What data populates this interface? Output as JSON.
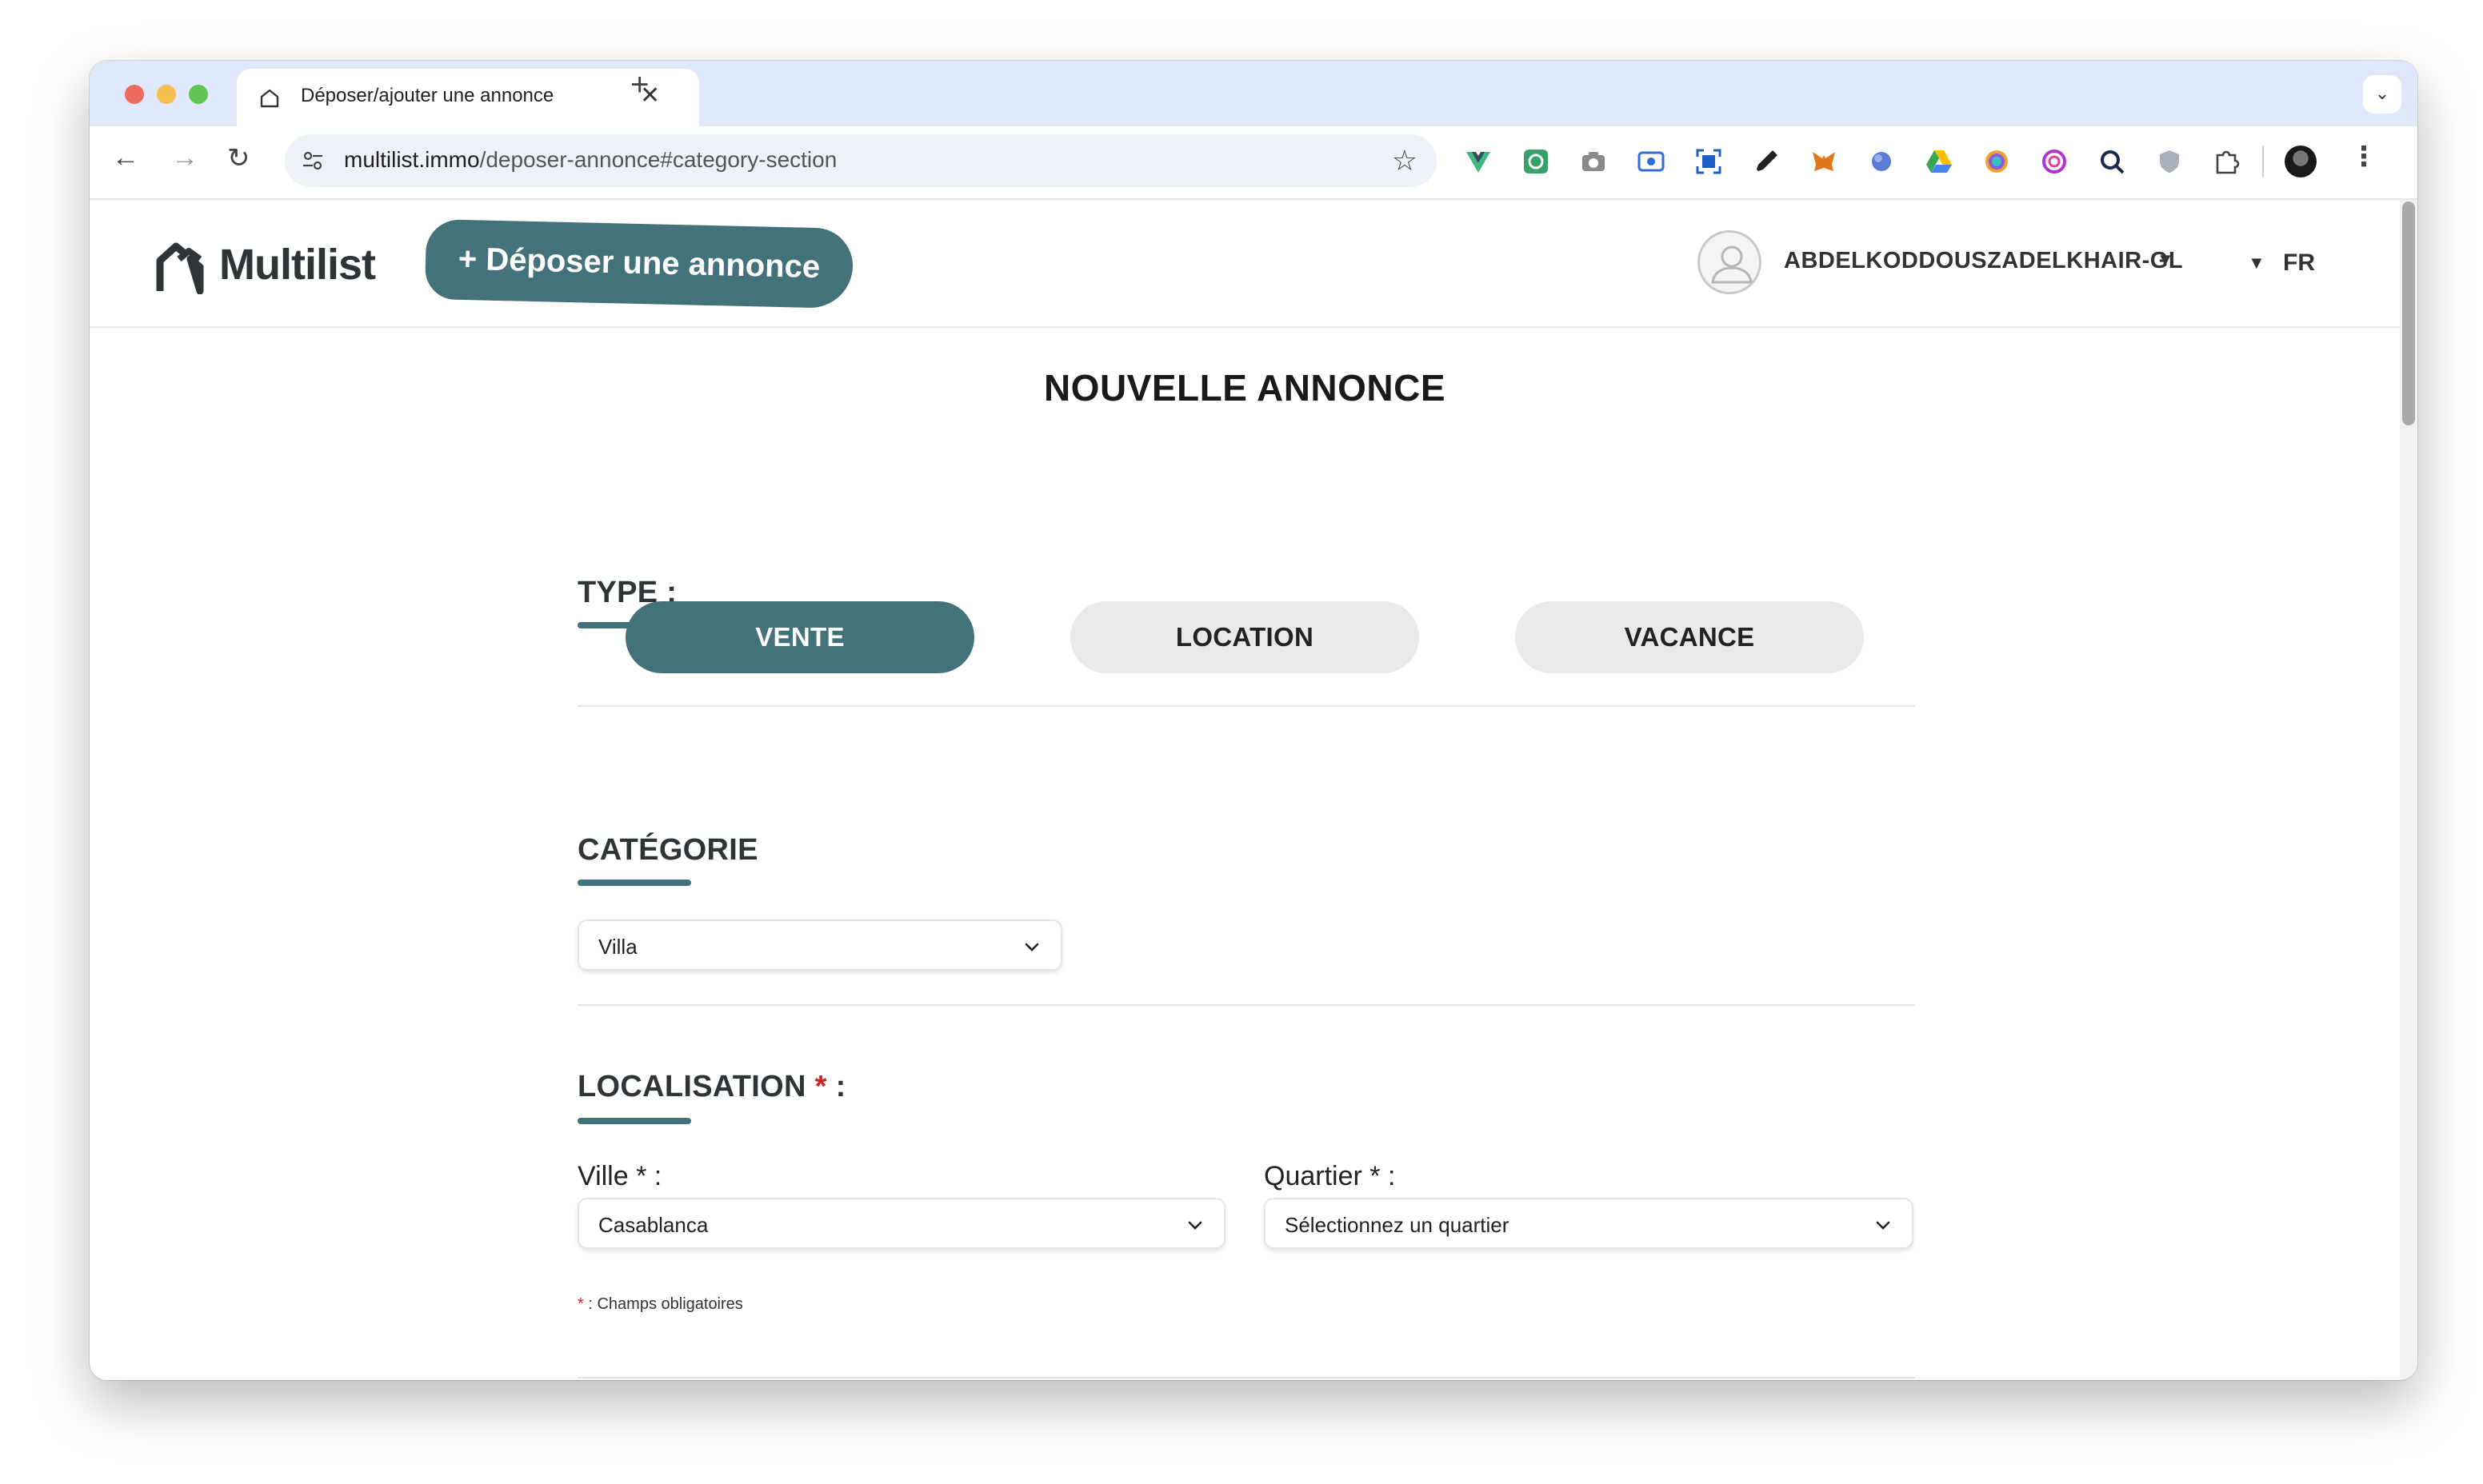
{
  "browser": {
    "tab_title": "Déposer/ajouter une annonce",
    "tab_close": "✕",
    "new_tab": "+",
    "url_host": "multilist.immo",
    "url_path": "/deposer-annonce#category-section",
    "extensions": [
      "vue-devtools-icon",
      "green-ext-icon",
      "camera-icon",
      "screen-record-icon",
      "screenshot-icon",
      "eyedropper-icon",
      "metamask-icon",
      "globe-ext-icon",
      "google-drive-icon",
      "rainbow-ext-icon",
      "swirl-ext-icon",
      "search-ext-icon",
      "shield-ext-icon",
      "puzzle-icon"
    ]
  },
  "header": {
    "logo_text": "Multilist",
    "post_button": "+ Déposer une annonce",
    "user_name": "ABDELKODDOUSZADELKHAIR-GL",
    "language": "FR"
  },
  "main": {
    "title": "NOUVELLE ANNONCE",
    "type_section": {
      "title": "TYPE :",
      "options": [
        "VENTE",
        "LOCATION",
        "VACANCE"
      ],
      "selected": "VENTE"
    },
    "category_section": {
      "title": "CATÉGORIE",
      "value": "Villa"
    },
    "location_section": {
      "title": "LOCALISATION",
      "required_mark": "*",
      "title_suffix": " :",
      "city_label": "Ville * :",
      "city_value": "Casablanca",
      "district_label": "Quartier * :",
      "district_value": "Sélectionnez un quartier"
    },
    "required_note": ": Champs obligatoires",
    "required_note_mark": "*"
  },
  "colors": {
    "brand": "#44727a",
    "required": "#d61f1f",
    "tab_bar": "#dfe8fb"
  }
}
